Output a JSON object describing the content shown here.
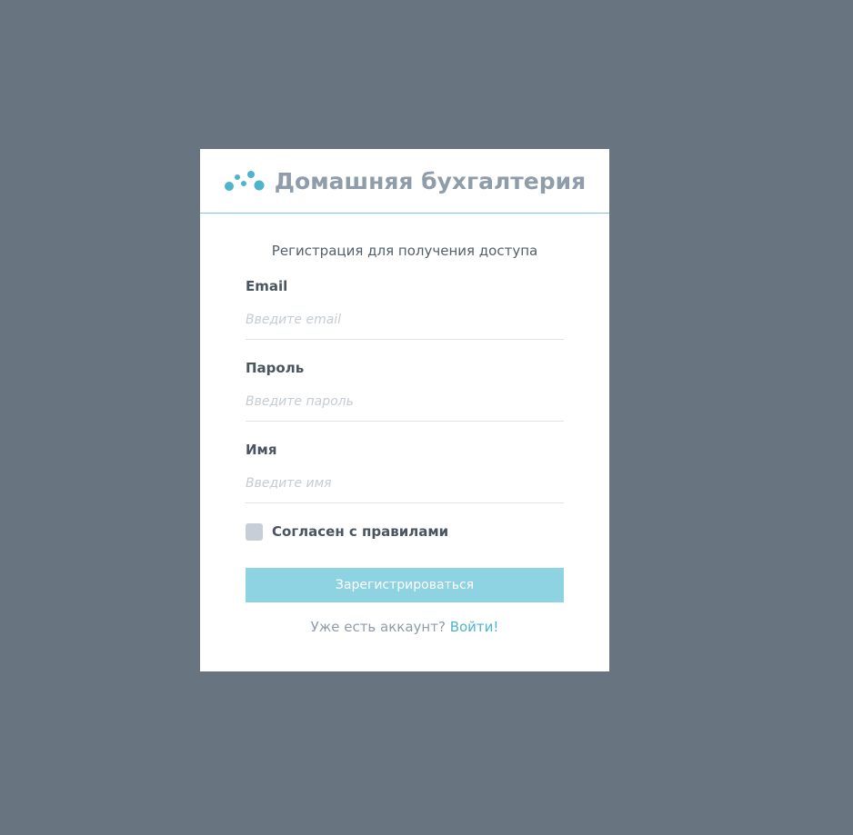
{
  "app": {
    "title": "Домашняя бухгалтерия",
    "logo_icon": "dots-logo-icon"
  },
  "colors": {
    "background": "#68747f",
    "accent": "#4eb4cc",
    "button": "#8dd3e2",
    "title": "#8f9dab"
  },
  "form": {
    "subtitle": "Регистрация для получения доступа",
    "email": {
      "label": "Email",
      "placeholder": "Введите email",
      "value": ""
    },
    "password": {
      "label": "Пароль",
      "placeholder": "Введите пароль",
      "value": ""
    },
    "name": {
      "label": "Имя",
      "placeholder": "Введите имя",
      "value": ""
    },
    "agree": {
      "label": "Согласен с правилами",
      "checked": false
    },
    "submit_label": "Зарегистрироваться"
  },
  "footer": {
    "question": "Уже есть аккаунт?",
    "login_link": "Войти!"
  }
}
